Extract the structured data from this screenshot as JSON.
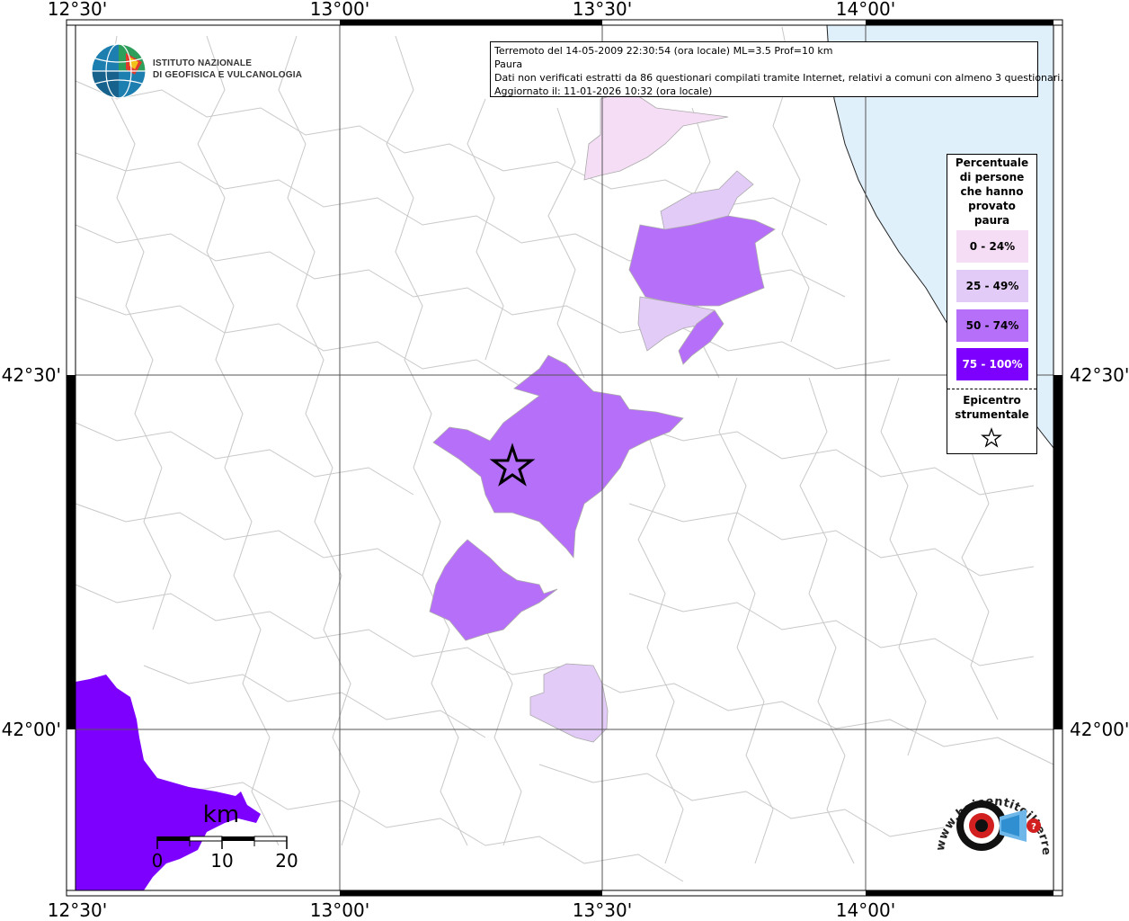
{
  "map": {
    "lon_labels": [
      "12°30'",
      "13°00'",
      "13°30'",
      "14°00'"
    ],
    "lat_labels": [
      "42°30'",
      "42°00'"
    ],
    "colors": {
      "sea": "#dff0fb",
      "c0_24": "#f6ddf6",
      "c25_49": "#e3cbf7",
      "c50_74": "#b66ff8",
      "c75_100": "#7d00ff",
      "boundary": "#c8c8c8"
    }
  },
  "info": {
    "line1": "Terremoto del 14-05-2009 22:30:54 (ora locale) ML=3.5 Prof=10 km",
    "line2": "Paura",
    "line3": "Dati non verificati estratti da 86 questionari compilati tramite Internet, relativi a comuni con almeno 3 questionari.",
    "line4": "Aggiornato il: 11-01-2026 10:32 (ora locale)"
  },
  "legend": {
    "title": [
      "Percentuale",
      "di persone",
      "che hanno",
      "provato",
      "paura"
    ],
    "items": [
      {
        "label": "0 - 24%",
        "color": "#f6ddf6",
        "text_color": "#000000"
      },
      {
        "label": "25 - 49%",
        "color": "#e3cbf7",
        "text_color": "#000000"
      },
      {
        "label": "50 - 74%",
        "color": "#b66ff8",
        "text_color": "#000000"
      },
      {
        "label": "75 - 100%",
        "color": "#7d00ff",
        "text_color": "#ffffff"
      }
    ],
    "epicenter_title": [
      "Epicentro",
      "strumentale"
    ],
    "epicenter_icon": "star-icon"
  },
  "scale": {
    "unit": "km",
    "ticks": [
      "0",
      "10",
      "20"
    ]
  },
  "logos": {
    "ingv_line1": "ISTITUTO NAZIONALE",
    "ingv_line2": "DI GEOFISICA E VULCANOLOGIA",
    "hst_text": "www.haisentitoilterremoto.it"
  }
}
